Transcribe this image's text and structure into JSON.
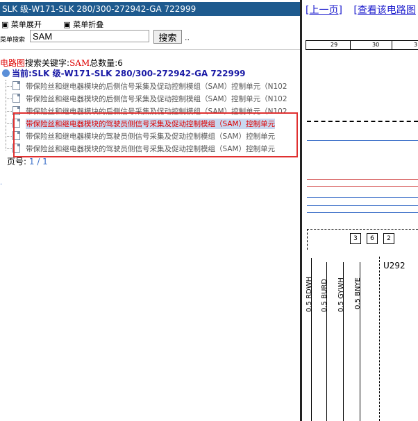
{
  "title": "SLK 级-W171-SLK 280/300-272942-GA 722999",
  "menu": {
    "expand": "菜单展开",
    "collapse": "菜单折叠"
  },
  "search": {
    "label": "菜单搜索",
    "value": "SAM",
    "button": "搜索",
    "dots": ".."
  },
  "result": {
    "prefix": "电路图",
    "keyword_label": "搜索关键字:",
    "keyword": "SAM",
    "count_label": "总数量:",
    "count": "6"
  },
  "current": {
    "label": "当前:SLK 级-W171-SLK 280/300-272942-GA 722999"
  },
  "items": [
    "带保险丝和继电器模块的后侧信号采集及促动控制模组（SAM）控制单元（N102",
    "带保险丝和继电器模块的后侧信号采集及促动控制模组（SAM）控制单元（N102",
    "带保险丝和继电器模块的后侧信号采集及促动控制模组（SAM）控制单元（N102",
    "带保险丝和继电器模块的驾驶员侧信号采集及促动控制模组（SAM）控制单元",
    "带保险丝和继电器模块的驾驶员侧信号采集及促动控制模组（SAM）控制单元",
    "带保险丝和继电器模块的驾驶员侧信号采集及促动控制模组（SAM）控制单元"
  ],
  "pager": {
    "label": "页号:",
    "value": "1 / 1"
  },
  "diagram": {
    "link_prev": "[上一页]",
    "link_view": "[查看该电路图",
    "ruler": [
      "29",
      "30",
      "3"
    ],
    "pins": [
      "3",
      "6",
      "2"
    ],
    "component": "U292",
    "wires": [
      "0,5 RDWH",
      "0,5 BURD",
      "0,5 GYWH",
      "0,5 BNYE"
    ]
  },
  "colors": {
    "titlebar": "#1e5a8e",
    "highlight": "#e03030",
    "link": "#1a1acc",
    "keyword": "#dd0000"
  }
}
